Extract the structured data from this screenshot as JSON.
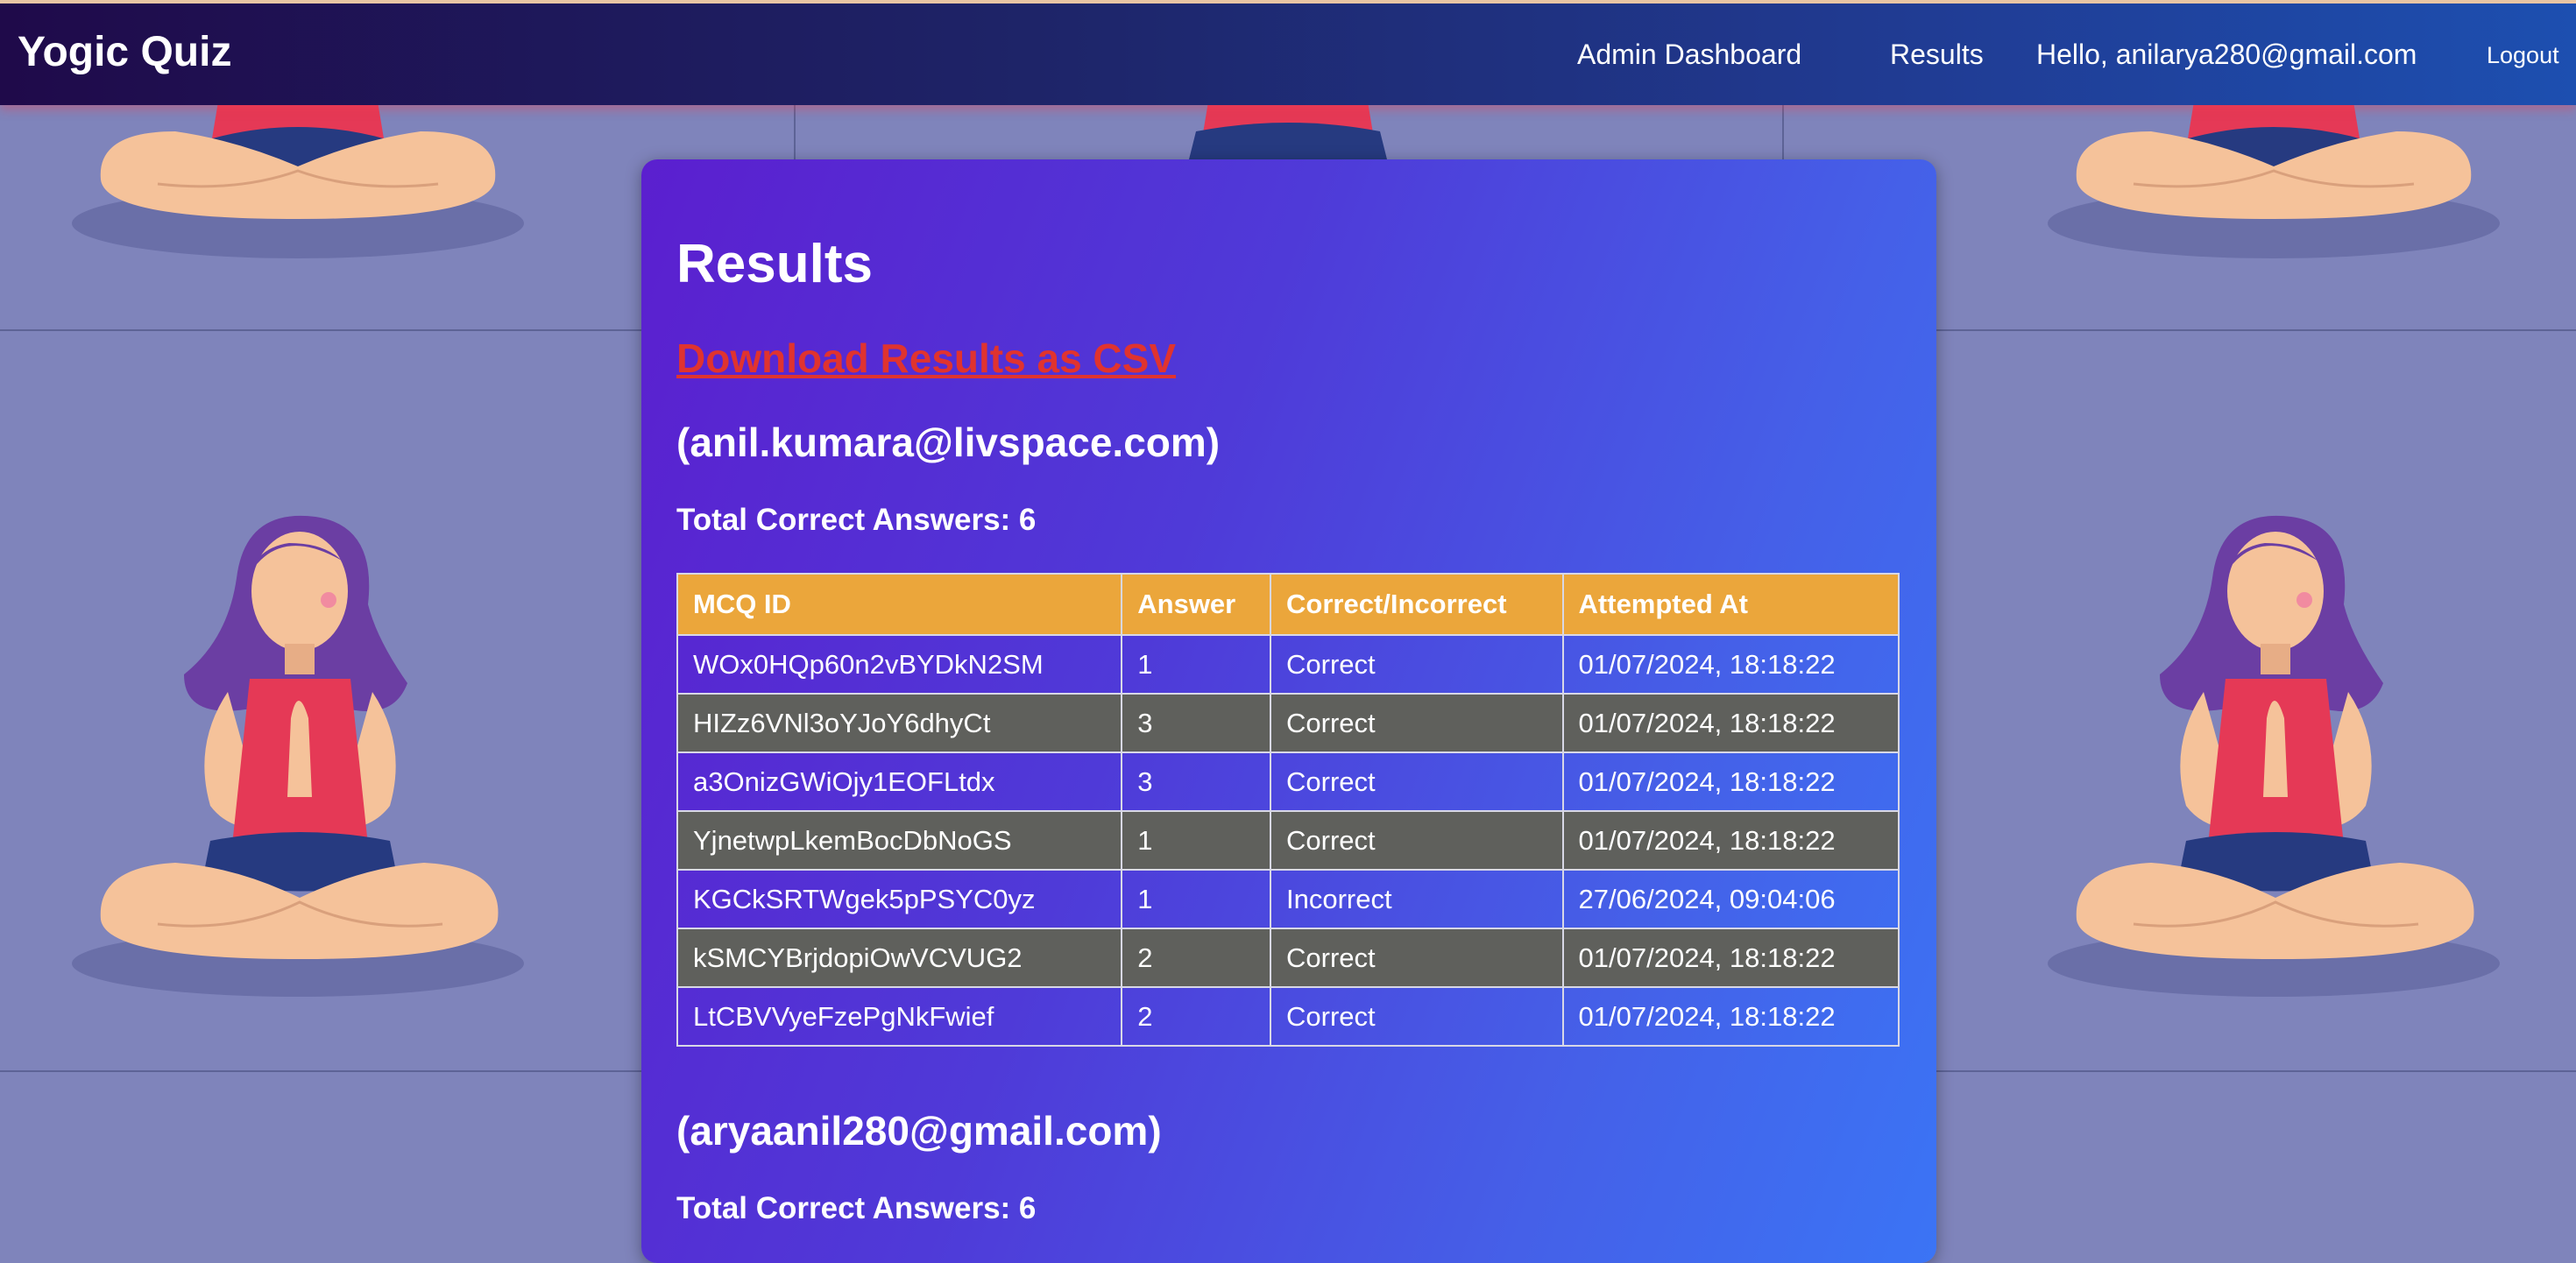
{
  "navbar": {
    "brand": "Yogic Quiz",
    "admin_dashboard": "Admin Dashboard",
    "results": "Results",
    "greeting": "Hello, anilarya280@gmail.com",
    "logout": "Logout"
  },
  "page": {
    "title": "Results",
    "download_csv": "Download Results as CSV"
  },
  "table_headers": [
    "MCQ ID",
    "Answer",
    "Correct/Incorrect",
    "Attempted At"
  ],
  "users": [
    {
      "email": "(anil.kumara@livspace.com)",
      "total": "Total Correct Answers: 6",
      "rows": [
        {
          "id": "WOx0HQp60n2vBYDkN2SM",
          "answer": "1",
          "result": "Correct",
          "at": "01/07/2024, 18:18:22"
        },
        {
          "id": "HIZz6VNl3oYJoY6dhyCt",
          "answer": "3",
          "result": "Correct",
          "at": "01/07/2024, 18:18:22"
        },
        {
          "id": "a3OnizGWiOjy1EOFLtdx",
          "answer": "3",
          "result": "Correct",
          "at": "01/07/2024, 18:18:22"
        },
        {
          "id": "YjnetwpLkemBocDbNoGS",
          "answer": "1",
          "result": "Correct",
          "at": "01/07/2024, 18:18:22"
        },
        {
          "id": "KGCkSRTWgek5pPSYC0yz",
          "answer": "1",
          "result": "Incorrect",
          "at": "27/06/2024, 09:04:06"
        },
        {
          "id": "kSMCYBrjdopiOwVCVUG2",
          "answer": "2",
          "result": "Correct",
          "at": "01/07/2024, 18:18:22"
        },
        {
          "id": "LtCBVVyeFzePgNkFwief",
          "answer": "2",
          "result": "Correct",
          "at": "01/07/2024, 18:18:22"
        }
      ]
    },
    {
      "email": "(aryaanil280@gmail.com)",
      "total": "Total Correct Answers: 6"
    }
  ],
  "colors": {
    "navbar_start": "#1f0a4a",
    "navbar_end": "#1d4fb0",
    "card_start": "#5b1fcf",
    "card_end": "#3b74f5",
    "table_header": "#eba63b",
    "row_alt": "#5f605c",
    "csv_link": "#e0332f",
    "background": "#7f84bb"
  },
  "background_icon": "meditating-woman-illustration"
}
